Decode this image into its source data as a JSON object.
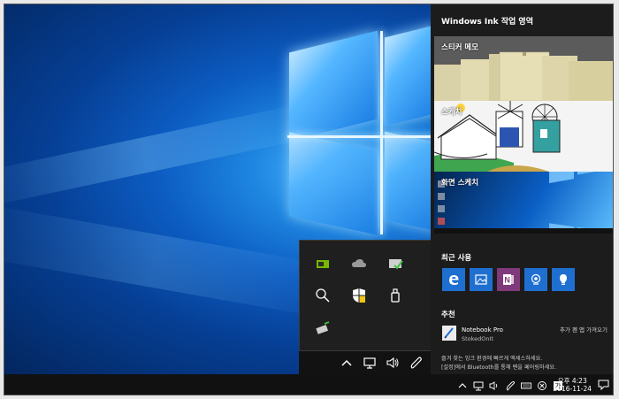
{
  "ink_workspace": {
    "title": "Windows Ink 작업 영역",
    "sticky_notes_label": "스티커 메모",
    "sketchpad_label": "스케치",
    "screen_sketch_label": "화면 스케치",
    "recent_label": "최근 사용",
    "recent_apps": [
      {
        "name": "edge-icon",
        "color": "#1f6fd0"
      },
      {
        "name": "photos-icon",
        "color": "#1f6fd0"
      },
      {
        "name": "onenote-icon",
        "color": "#80397b"
      },
      {
        "name": "camera-icon",
        "color": "#1f6fd0"
      },
      {
        "name": "tips-icon",
        "color": "#1f6fd0"
      }
    ],
    "suggested_label": "추천",
    "suggested_app": {
      "name": "Notebook Pro",
      "publisher": "StokedOnIt",
      "action": "추가 펜 앱 가져오기"
    },
    "description_line1": "즐겨 찾는 잉크 환경에 빠르게 액세스하세요.",
    "description_line2": "[설정]에서 Bluetooth를 통해 펜을 페어링하세요."
  },
  "taskbar": {
    "time": "오후 4:23",
    "date": "2016-11-24"
  },
  "colors": {
    "panel_bg": "#1c1c1c",
    "accent": "#1f6fd0",
    "taskbar_bg": "#111111"
  }
}
